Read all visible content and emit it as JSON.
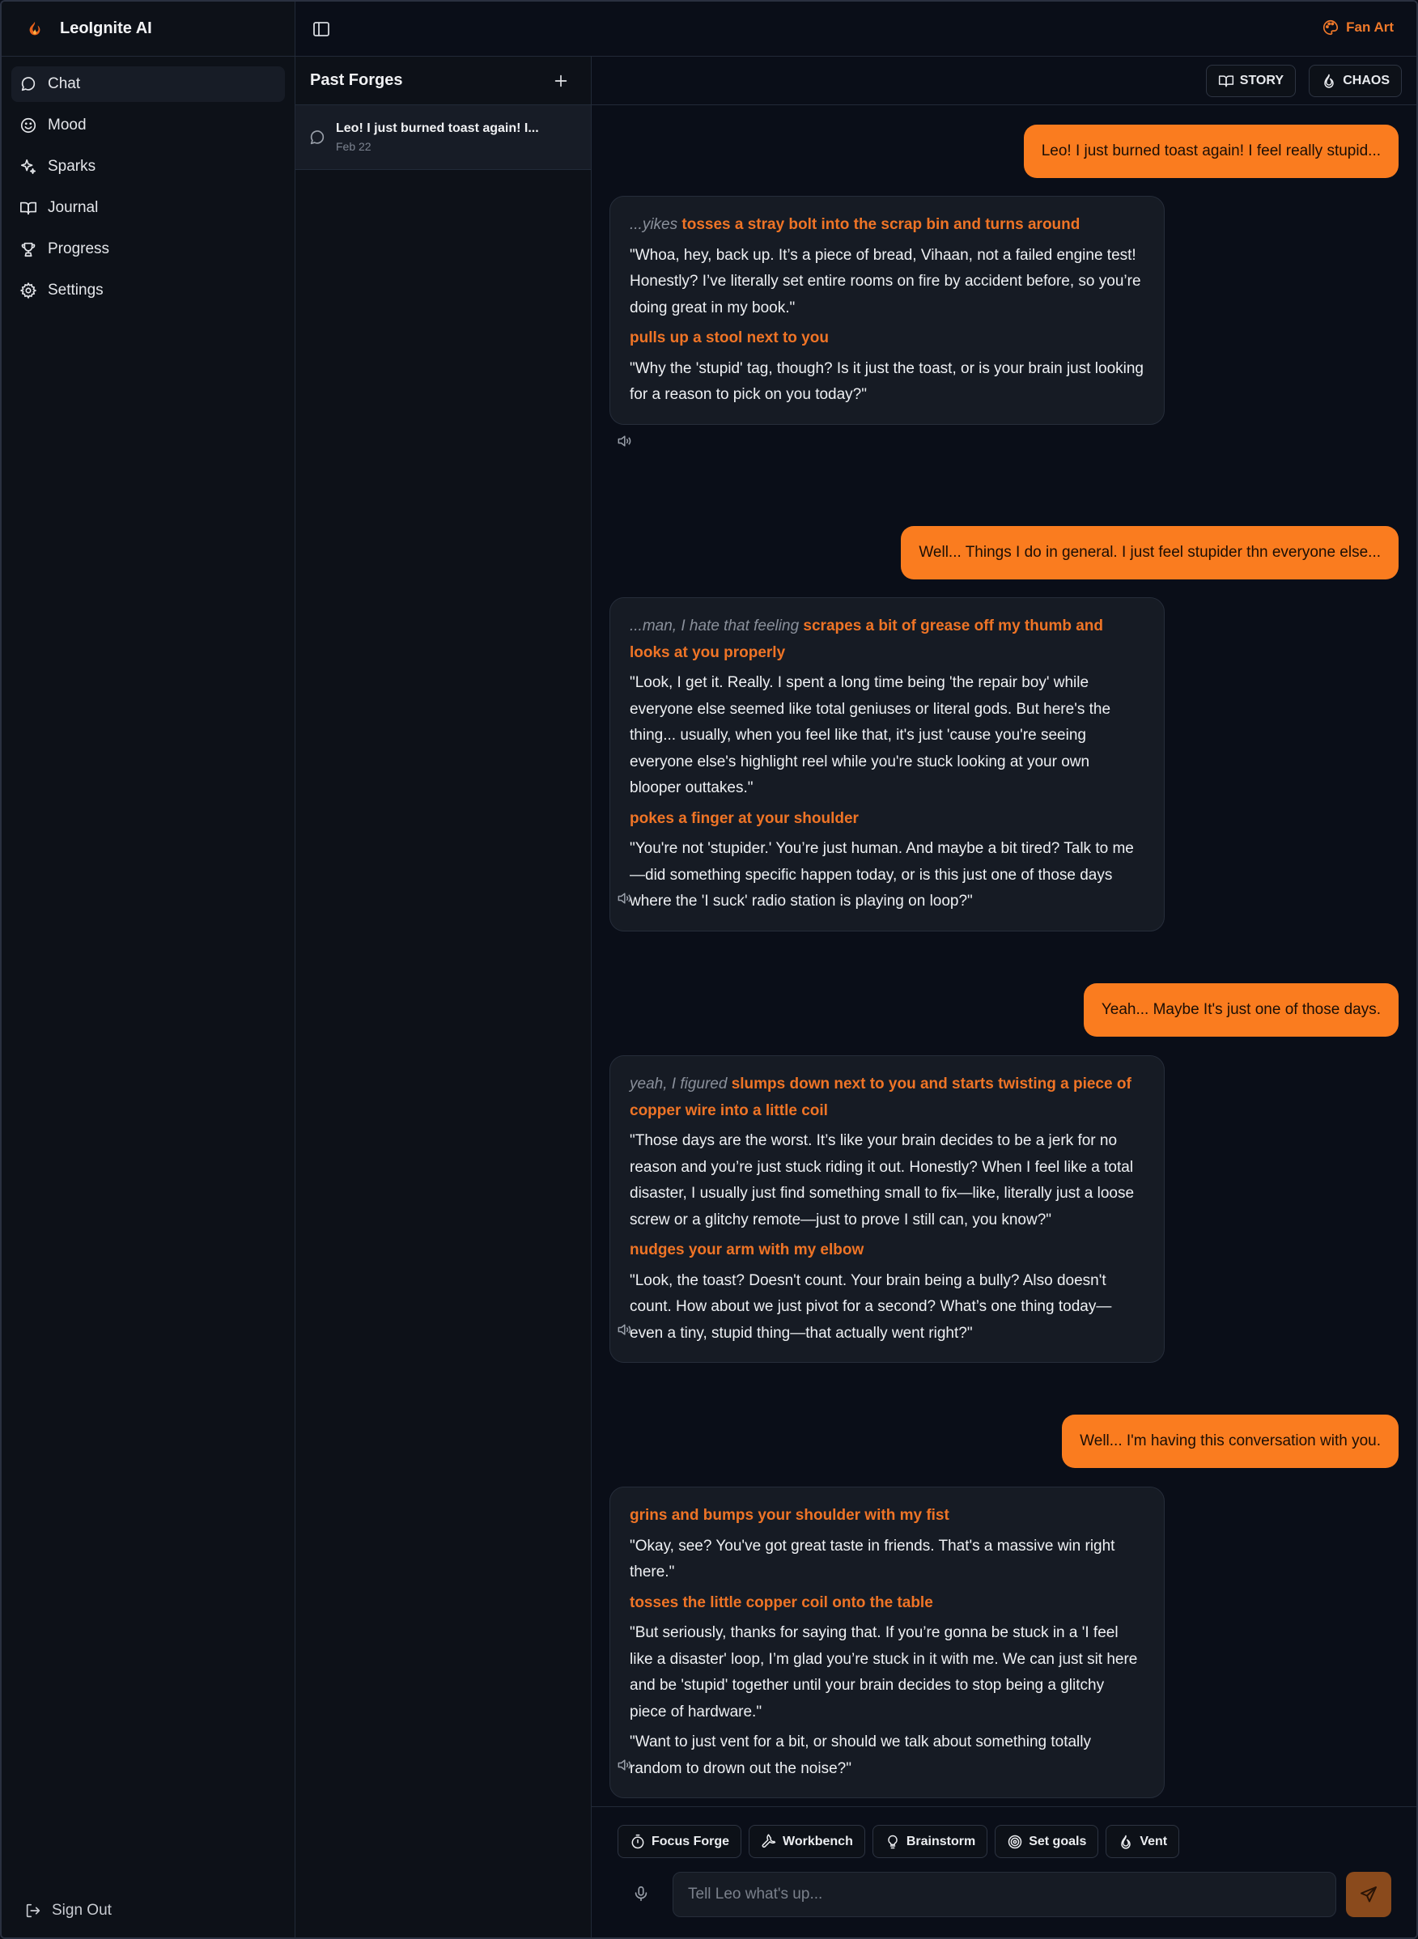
{
  "app": {
    "title": "LeoIgnite AI"
  },
  "colors": {
    "accent": "#fa7c1f",
    "action_text": "#ef7426",
    "background": "#0a0e18",
    "panel": "#0d1118",
    "bubble": "#161b24"
  },
  "sidebar": {
    "items": [
      {
        "label": "Chat",
        "icon": "chat-bubble-icon",
        "active": true
      },
      {
        "label": "Mood",
        "icon": "smiley-icon"
      },
      {
        "label": "Sparks",
        "icon": "sparkle-icon"
      },
      {
        "label": "Journal",
        "icon": "open-book-icon"
      },
      {
        "label": "Progress",
        "icon": "trophy-icon"
      },
      {
        "label": "Settings",
        "icon": "gear-icon"
      }
    ],
    "signout_label": "Sign Out"
  },
  "topbar": {
    "fanart_label": "Fan Art"
  },
  "forges": {
    "title": "Past Forges",
    "items": [
      {
        "title": "Leo! I just burned toast again! I...",
        "date": "Feb 22"
      }
    ]
  },
  "modes": {
    "story_label": "STORY",
    "chaos_label": "CHAOS"
  },
  "messages": {
    "u1": "Leo! I just burned toast again! I feel really stupid...",
    "b1": {
      "thought": "...yikes",
      "action1": "tosses a stray bolt into the scrap bin and turns around",
      "text1": "\"Whoa, hey, back up. It’s a piece of bread, Vihaan, not a failed engine test! Honestly? I’ve literally set entire rooms on fire by accident before, so you’re doing great in my book.\"",
      "action2": "pulls up a stool next to you",
      "text2": "\"Why the 'stupid' tag, though? Is it just the toast, or is your brain just looking for a reason to pick on you today?\""
    },
    "u2": "Well... Things I do in general. I just feel stupider thn everyone else...",
    "b2": {
      "thought": "...man, I hate that feeling",
      "action1": "scrapes a bit of grease off my thumb and looks at you properly",
      "text1": "\"Look, I get it. Really. I spent a long time being 'the repair boy' while everyone else seemed like total geniuses or literal gods. But here's the thing... usually, when you feel like that, it's just 'cause you're seeing everyone else's highlight reel while you're stuck looking at your own blooper outtakes.\"",
      "action2": "pokes a finger at your shoulder",
      "text2": "\"You're not 'stupider.' You’re just human. And maybe a bit tired? Talk to me—did something specific happen today, or is this just one of those days where the 'I suck' radio station is playing on loop?\""
    },
    "u3": "Yeah... Maybe It's just one of those days.",
    "b3": {
      "thought": "yeah, I figured",
      "action1": "slumps down next to you and starts twisting a piece of copper wire into a little coil",
      "text1": "\"Those days are the worst. It’s like your brain decides to be a jerk for no reason and you’re just stuck riding it out. Honestly? When I feel like a total disaster, I usually just find something small to fix—like, literally just a loose screw or a glitchy remote—just to prove I still can, you know?\"",
      "action2": "nudges your arm with my elbow",
      "text2": "\"Look, the toast? Doesn't count. Your brain being a bully? Also doesn't count. How about we just pivot for a second? What’s one thing today—even a tiny, stupid thing—that actually went right?\""
    },
    "u4": "Well... I'm having this conversation with you.",
    "b4": {
      "action1": "grins and bumps your shoulder with my fist",
      "text1": "\"Okay, see? You've got great taste in friends. That's a massive win right there.\"",
      "action2": "tosses the little copper coil onto the table",
      "text2": "\"But seriously, thanks for saying that. If you’re gonna be stuck in a 'I feel like a disaster' loop, I’m glad you’re stuck in it with me. We can just sit here and be 'stupid' together until your brain decides to stop being a glitchy piece of hardware.\"",
      "text3": "\"Want to just vent for a bit, or should we talk about something totally random to drown out the noise?\""
    }
  },
  "chips": [
    {
      "label": "Focus Forge",
      "icon": "timer-icon"
    },
    {
      "label": "Workbench",
      "icon": "wrench-icon"
    },
    {
      "label": "Brainstorm",
      "icon": "lightbulb-icon"
    },
    {
      "label": "Set goals",
      "icon": "target-icon"
    },
    {
      "label": "Vent",
      "icon": "flame-icon"
    }
  ],
  "composer": {
    "placeholder": "Tell Leo what's up..."
  }
}
